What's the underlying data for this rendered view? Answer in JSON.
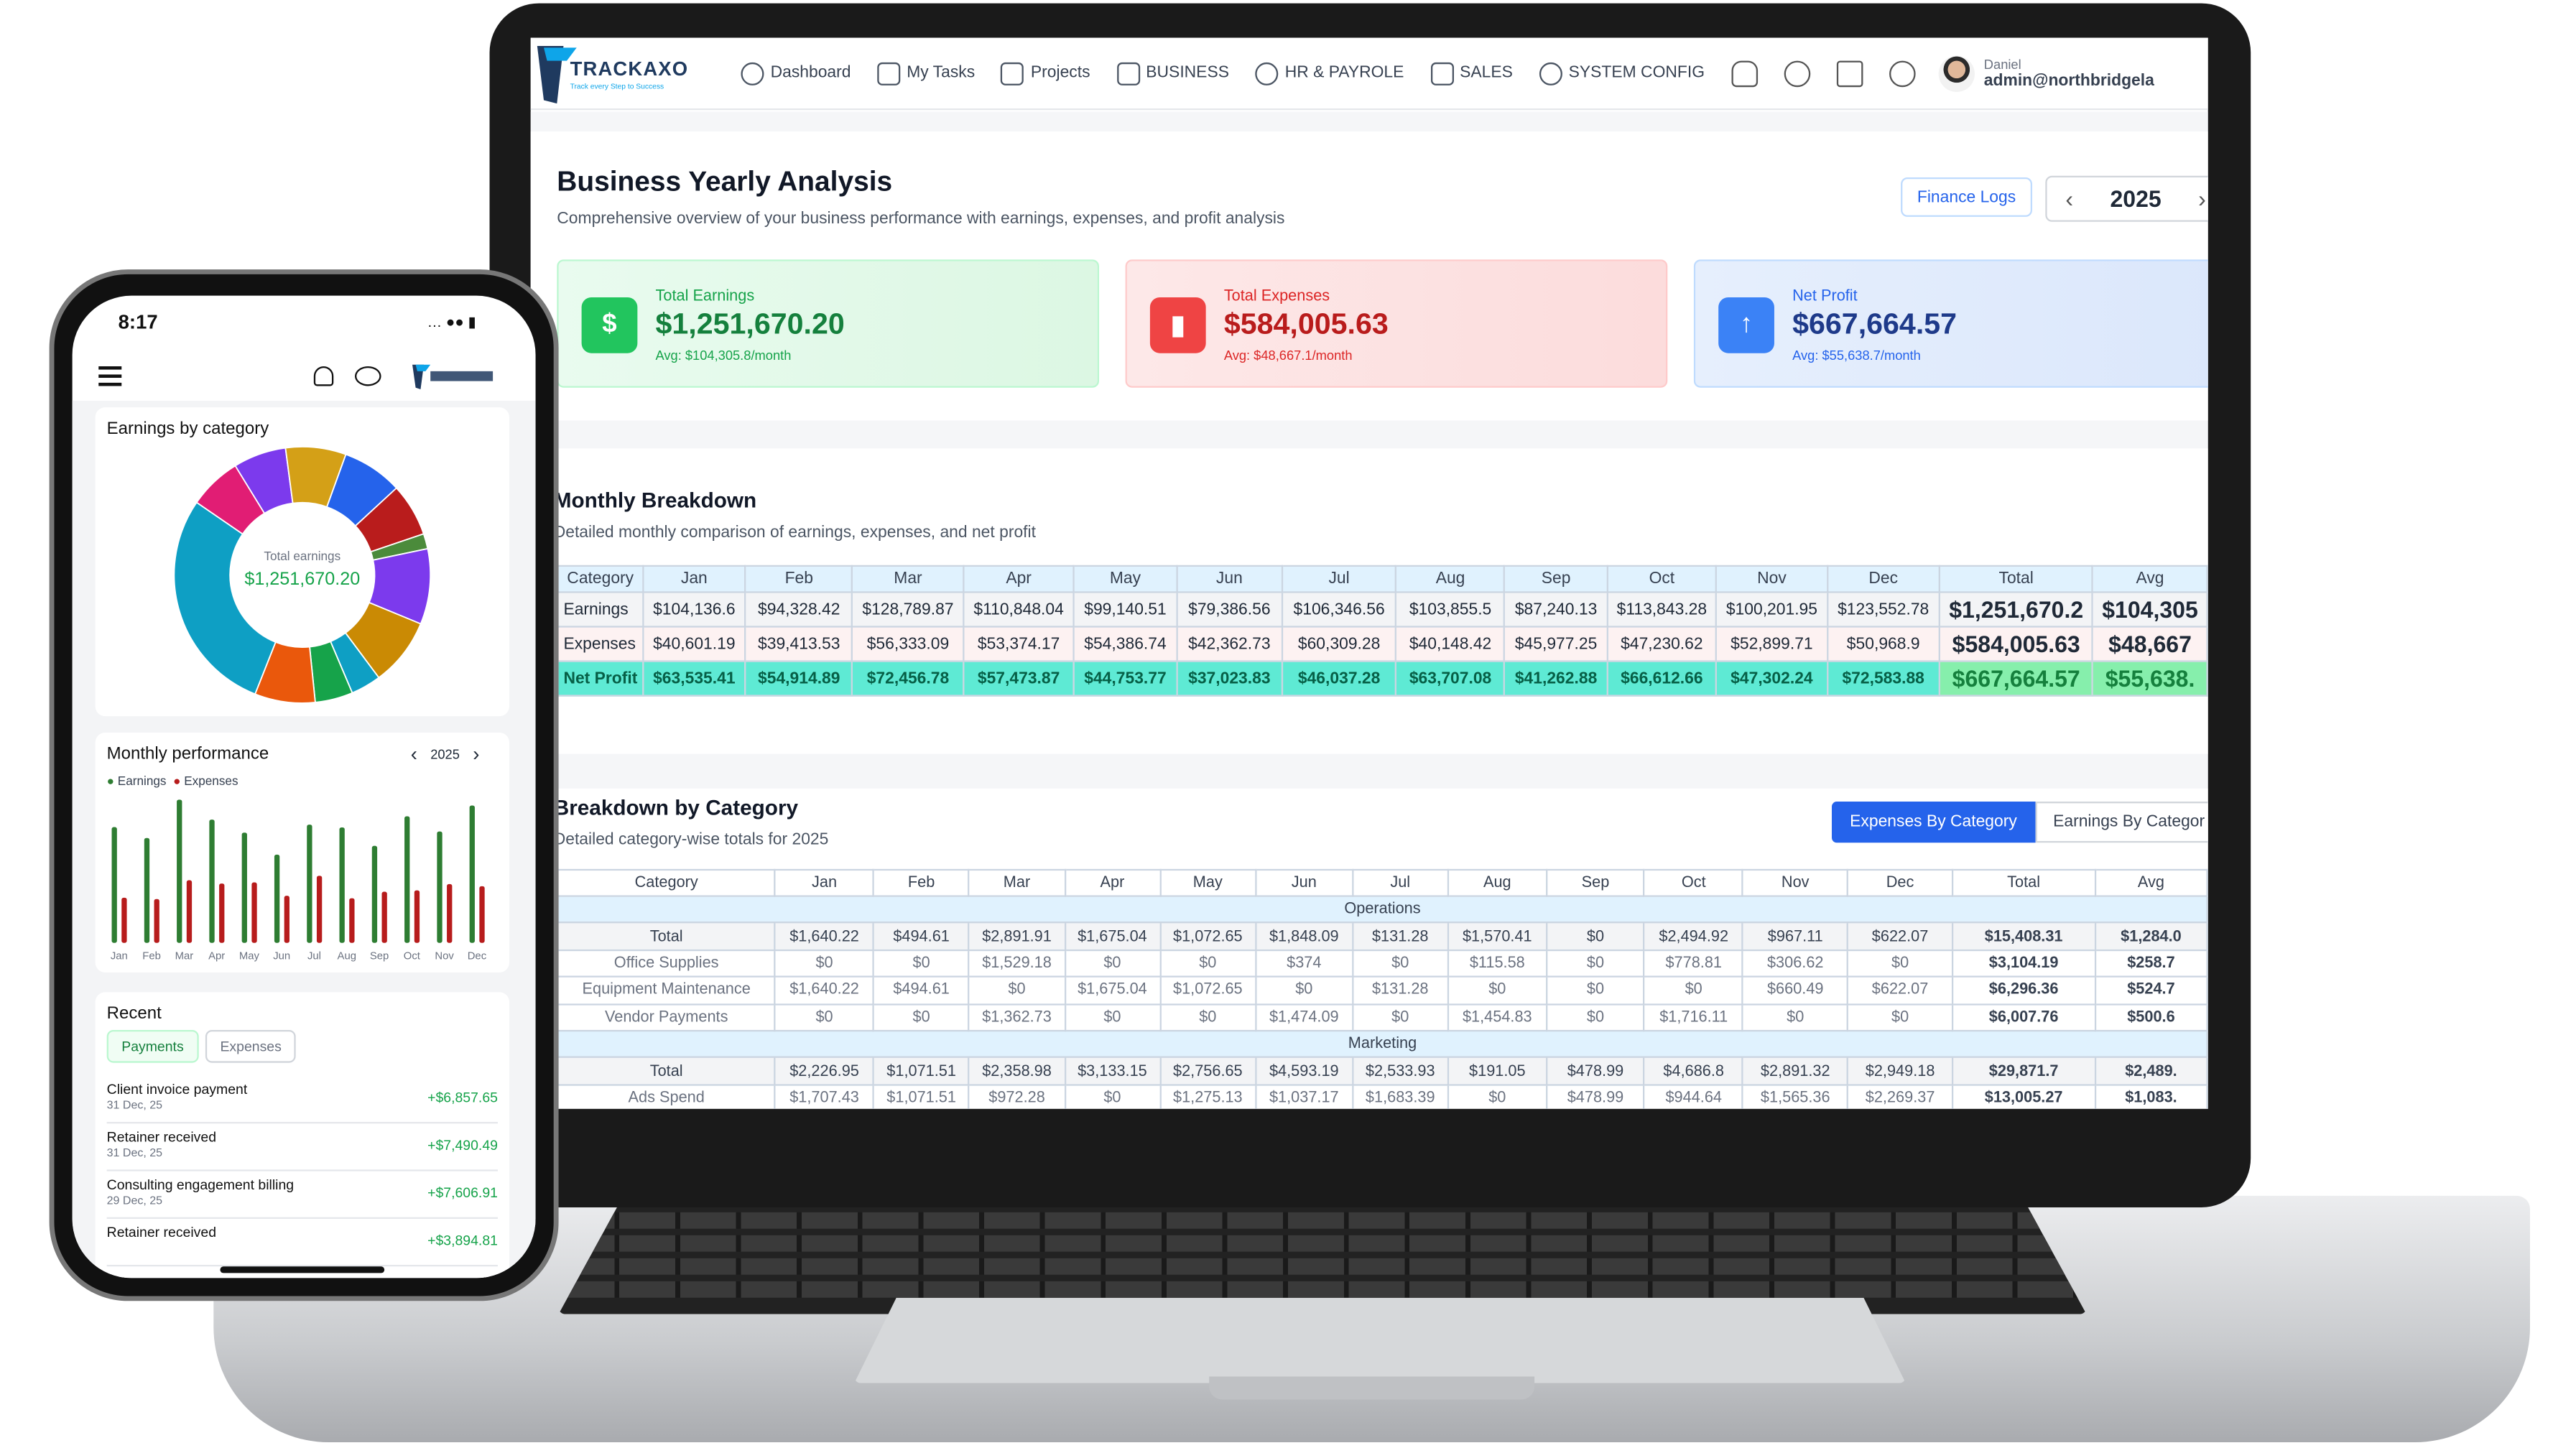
{
  "desktop": {
    "brand": "TRACKAXO",
    "tagline": "Track every Step to Success",
    "nav": [
      "Dashboard",
      "My Tasks",
      "Projects",
      "BUSINESS",
      "HR & PAYROLE",
      "SALES",
      "SYSTEM CONFIG"
    ],
    "user": {
      "name": "Daniel",
      "email": "admin@northbridgela"
    },
    "page_title": "Business Yearly Analysis",
    "page_subtitle": "Comprehensive overview of your business performance with earnings, expenses, and profit analysis",
    "finance_logs": "Finance Logs",
    "year": "2025",
    "cards": [
      {
        "label": "Total Earnings",
        "value": "$1,251,670.20",
        "avg": "Avg: $104,305.8/month",
        "color": "#16a34a"
      },
      {
        "label": "Total Expenses",
        "value": "$584,005.63",
        "avg": "Avg: $48,667.1/month",
        "color": "#dc2626"
      },
      {
        "label": "Net Profit",
        "value": "$667,664.57",
        "avg": "Avg: $55,638.7/month",
        "color": "#2563eb"
      }
    ],
    "monthly": {
      "title": "Monthly Breakdown",
      "subtitle": "Detailed monthly comparison of earnings, expenses, and net profit",
      "headers": [
        "Category",
        "Jan",
        "Feb",
        "Mar",
        "Apr",
        "May",
        "Jun",
        "Jul",
        "Aug",
        "Sep",
        "Oct",
        "Nov",
        "Dec",
        "Total",
        "Avg"
      ],
      "rows": [
        [
          "Earnings",
          "$104,136.6",
          "$94,328.42",
          "$128,789.87",
          "$110,848.04",
          "$99,140.51",
          "$79,386.56",
          "$106,346.56",
          "$103,855.5",
          "$87,240.13",
          "$113,843.28",
          "$100,201.95",
          "$123,552.78",
          "$1,251,670.2",
          "$104,305"
        ],
        [
          "Expenses",
          "$40,601.19",
          "$39,413.53",
          "$56,333.09",
          "$53,374.17",
          "$54,386.74",
          "$42,362.73",
          "$60,309.28",
          "$40,148.42",
          "$45,977.25",
          "$47,230.62",
          "$52,899.71",
          "$50,968.9",
          "$584,005.63",
          "$48,667"
        ],
        [
          "Net Profit",
          "$63,535.41",
          "$54,914.89",
          "$72,456.78",
          "$57,473.87",
          "$44,753.77",
          "$37,023.83",
          "$46,037.28",
          "$63,707.08",
          "$41,262.88",
          "$66,612.66",
          "$47,302.24",
          "$72,583.88",
          "$667,664.57",
          "$55,638."
        ]
      ]
    },
    "category": {
      "title": "Breakdown by Category",
      "subtitle": "Detailed category-wise totals for 2025",
      "tabs": [
        "Expenses By Category",
        "Earnings By Categor"
      ],
      "headers": [
        "Category",
        "Jan",
        "Feb",
        "Mar",
        "Apr",
        "May",
        "Jun",
        "Jul",
        "Aug",
        "Sep",
        "Oct",
        "Nov",
        "Dec",
        "Total",
        "Avg"
      ],
      "groups": [
        {
          "name": "Operations",
          "rows": [
            [
              "Total",
              "$1,640.22",
              "$494.61",
              "$2,891.91",
              "$1,675.04",
              "$1,072.65",
              "$1,848.09",
              "$131.28",
              "$1,570.41",
              "$0",
              "$2,494.92",
              "$967.11",
              "$622.07",
              "$15,408.31",
              "$1,284.0"
            ],
            [
              "Office Supplies",
              "$0",
              "$0",
              "$1,529.18",
              "$0",
              "$0",
              "$374",
              "$0",
              "$115.58",
              "$0",
              "$778.81",
              "$306.62",
              "$0",
              "$3,104.19",
              "$258.7"
            ],
            [
              "Equipment Maintenance",
              "$1,640.22",
              "$494.61",
              "$0",
              "$1,675.04",
              "$1,072.65",
              "$0",
              "$131.28",
              "$0",
              "$0",
              "$0",
              "$660.49",
              "$622.07",
              "$6,296.36",
              "$524.7"
            ],
            [
              "Vendor Payments",
              "$0",
              "$0",
              "$1,362.73",
              "$0",
              "$0",
              "$1,474.09",
              "$0",
              "$1,454.83",
              "$0",
              "$1,716.11",
              "$0",
              "$0",
              "$6,007.76",
              "$500.6"
            ]
          ]
        },
        {
          "name": "Marketing",
          "rows": [
            [
              "Total",
              "$2,226.95",
              "$1,071.51",
              "$2,358.98",
              "$3,133.15",
              "$2,756.65",
              "$4,593.19",
              "$2,533.93",
              "$191.05",
              "$478.99",
              "$4,686.8",
              "$2,891.32",
              "$2,949.18",
              "$29,871.7",
              "$2,489."
            ],
            [
              "Ads Spend",
              "$1,707.43",
              "$1,071.51",
              "$972.28",
              "$0",
              "$1,275.13",
              "$1,037.17",
              "$1,683.39",
              "$0",
              "$478.99",
              "$944.64",
              "$1,565.36",
              "$2,269.37",
              "$13,005.27",
              "$1,083."
            ]
          ]
        }
      ]
    }
  },
  "mobile": {
    "time": "8:17",
    "donut": {
      "title": "Earnings by category",
      "center_label": "Total earnings",
      "center_value": "$1,251,670.20"
    },
    "monthly": {
      "title": "Monthly performance",
      "year": "2025",
      "legend": [
        "Earnings",
        "Expenses"
      ]
    },
    "recent": {
      "title": "Recent",
      "tabs": [
        "Payments",
        "Expenses"
      ],
      "items": [
        {
          "title": "Client invoice payment",
          "date": "31 Dec, 25",
          "amount": "+$6,857.65"
        },
        {
          "title": "Retainer received",
          "date": "31 Dec, 25",
          "amount": "+$7,490.49"
        },
        {
          "title": "Consulting engagement billing",
          "date": "29 Dec, 25",
          "amount": "+$7,606.91"
        },
        {
          "title": "Retainer received",
          "date": "",
          "amount": "+$3,894.81"
        }
      ]
    }
  },
  "chart_data": [
    {
      "type": "pie",
      "title": "Earnings by category",
      "slices": [
        {
          "value": 30,
          "color": "#0e9fc4"
        },
        {
          "value": 7,
          "color": "#e11d74"
        },
        {
          "value": 7,
          "color": "#7c3aed"
        },
        {
          "value": 8,
          "color": "#d4a017"
        },
        {
          "value": 8,
          "color": "#2563eb"
        },
        {
          "value": 7,
          "color": "#b91c1c"
        },
        {
          "value": 2,
          "color": "#4b8b3b"
        },
        {
          "value": 10,
          "color": "#7c3aed"
        },
        {
          "value": 9,
          "color": "#ca8a04"
        },
        {
          "value": 4,
          "color": "#0e9fc4"
        },
        {
          "value": 5,
          "color": "#16a34a"
        },
        {
          "value": 8,
          "color": "#ea580c"
        }
      ]
    },
    {
      "type": "bar",
      "title": "Monthly performance",
      "categories": [
        "Jan",
        "Feb",
        "Mar",
        "Apr",
        "May",
        "Jun",
        "Jul",
        "Aug",
        "Sep",
        "Oct",
        "Nov",
        "Dec"
      ],
      "series": [
        {
          "name": "Earnings",
          "color": "#2e7d32",
          "values": [
            104136.6,
            94328.42,
            128789.87,
            110848.04,
            99140.51,
            79386.56,
            106346.56,
            103855.5,
            87240.13,
            113843.28,
            100201.95,
            123552.78
          ]
        },
        {
          "name": "Expenses",
          "color": "#b71c1c",
          "values": [
            40601.19,
            39413.53,
            56333.09,
            53374.17,
            54386.74,
            42362.73,
            60309.28,
            40148.42,
            45977.25,
            47230.62,
            52899.71,
            50968.9
          ]
        }
      ],
      "ylim": [
        0,
        130000
      ]
    }
  ]
}
